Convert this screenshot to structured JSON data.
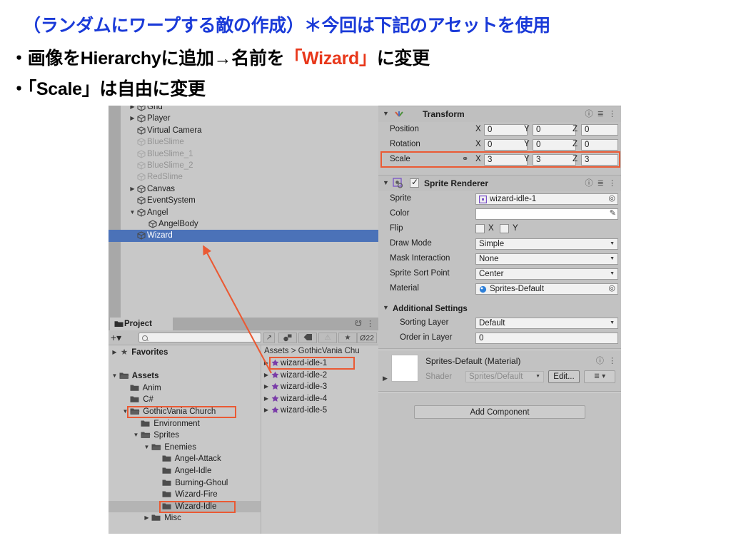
{
  "slide": {
    "line1": "（ランダムにワープする敵の作成）＊今回は下記のアセットを使用",
    "line2_a": "・画像をHierarchyに追加→名前を",
    "line2_b": "「Wizard」",
    "line2_c": "に変更",
    "line3": "・「Scale」は自由に変更",
    "accent_blue": "#1a3ad8",
    "accent_red": "#e8371a",
    "annotation_color": "#ea5a34"
  },
  "hierarchy": {
    "items": [
      {
        "label": "Grid",
        "indent": 1,
        "twisty": "▶",
        "state": "normal"
      },
      {
        "label": "Player",
        "indent": 1,
        "twisty": "▶",
        "state": "normal"
      },
      {
        "label": "Virtual Camera",
        "indent": 1,
        "twisty": "",
        "state": "normal"
      },
      {
        "label": "BlueSlime",
        "indent": 1,
        "twisty": "",
        "state": "dim"
      },
      {
        "label": "BlueSlime_1",
        "indent": 1,
        "twisty": "",
        "state": "dim"
      },
      {
        "label": "BlueSlime_2",
        "indent": 1,
        "twisty": "",
        "state": "dim"
      },
      {
        "label": "RedSlime",
        "indent": 1,
        "twisty": "",
        "state": "dim"
      },
      {
        "label": "Canvas",
        "indent": 1,
        "twisty": "▶",
        "state": "normal"
      },
      {
        "label": "EventSystem",
        "indent": 1,
        "twisty": "",
        "state": "normal"
      },
      {
        "label": "Angel",
        "indent": 1,
        "twisty": "▼",
        "state": "normal"
      },
      {
        "label": "AngelBody",
        "indent": 2,
        "twisty": "",
        "state": "normal"
      },
      {
        "label": "Wizard",
        "indent": 1,
        "twisty": "",
        "state": "selected"
      }
    ]
  },
  "project": {
    "tab_label": "Project",
    "search_placeholder": "",
    "hidden_count": "22",
    "breadcrumb": "Assets > GothicVania Chu",
    "tree": [
      {
        "label": "Favorites",
        "indent": 0,
        "twisty": "▶",
        "icon": "star",
        "bold": true,
        "selected": false,
        "boxed": false
      },
      {
        "label": "",
        "indent": 0,
        "twisty": "",
        "icon": "none",
        "bold": false,
        "selected": false,
        "boxed": false
      },
      {
        "label": "Assets",
        "indent": 0,
        "twisty": "▼",
        "icon": "folder-open",
        "bold": true,
        "selected": false,
        "boxed": false
      },
      {
        "label": "Anim",
        "indent": 1,
        "twisty": "",
        "icon": "folder",
        "bold": false,
        "selected": false,
        "boxed": false
      },
      {
        "label": "C#",
        "indent": 1,
        "twisty": "",
        "icon": "folder",
        "bold": false,
        "selected": false,
        "boxed": false
      },
      {
        "label": "GothicVania Church",
        "indent": 1,
        "twisty": "▼",
        "icon": "folder-open",
        "bold": false,
        "selected": false,
        "boxed": true
      },
      {
        "label": "Environment",
        "indent": 2,
        "twisty": "",
        "icon": "folder",
        "bold": false,
        "selected": false,
        "boxed": false
      },
      {
        "label": "Sprites",
        "indent": 2,
        "twisty": "▼",
        "icon": "folder-open",
        "bold": false,
        "selected": false,
        "boxed": false
      },
      {
        "label": "Enemies",
        "indent": 3,
        "twisty": "▼",
        "icon": "folder-open",
        "bold": false,
        "selected": false,
        "boxed": false
      },
      {
        "label": "Angel-Attack",
        "indent": 4,
        "twisty": "",
        "icon": "folder",
        "bold": false,
        "selected": false,
        "boxed": false
      },
      {
        "label": "Angel-Idle",
        "indent": 4,
        "twisty": "",
        "icon": "folder",
        "bold": false,
        "selected": false,
        "boxed": false
      },
      {
        "label": "Burning-Ghoul",
        "indent": 4,
        "twisty": "",
        "icon": "folder",
        "bold": false,
        "selected": false,
        "boxed": false
      },
      {
        "label": "Wizard-Fire",
        "indent": 4,
        "twisty": "",
        "icon": "folder",
        "bold": false,
        "selected": false,
        "boxed": false
      },
      {
        "label": "Wizard-Idle",
        "indent": 4,
        "twisty": "",
        "icon": "folder",
        "bold": false,
        "selected": true,
        "boxed": true
      },
      {
        "label": "Misc",
        "indent": 3,
        "twisty": "▶",
        "icon": "folder",
        "bold": false,
        "selected": false,
        "boxed": false
      }
    ],
    "assets": [
      {
        "label": "wizard-idle-1",
        "boxed": true
      },
      {
        "label": "wizard-idle-2",
        "boxed": false
      },
      {
        "label": "wizard-idle-3",
        "boxed": false
      },
      {
        "label": "wizard-idle-4",
        "boxed": false
      },
      {
        "label": "wizard-idle-5",
        "boxed": false
      }
    ]
  },
  "inspector": {
    "transform": {
      "title": "Transform",
      "rows": [
        {
          "label": "Position",
          "x": "0",
          "y": "0",
          "z": "0",
          "boxed": false,
          "link": false
        },
        {
          "label": "Rotation",
          "x": "0",
          "y": "0",
          "z": "0",
          "boxed": false,
          "link": false
        },
        {
          "label": "Scale",
          "x": "3",
          "y": "3",
          "z": "3",
          "boxed": true,
          "link": true
        }
      ],
      "axis_x": "X",
      "axis_y": "Y",
      "axis_z": "Z"
    },
    "sprite_renderer": {
      "title": "Sprite Renderer",
      "enabled": true,
      "fields": [
        {
          "label": "Sprite",
          "value": "wizard-idle-1",
          "kind": "object"
        },
        {
          "label": "Color",
          "value": "",
          "kind": "color"
        },
        {
          "label": "Flip",
          "value": "",
          "kind": "flip",
          "x_label": "X",
          "y_label": "Y"
        },
        {
          "label": "Draw Mode",
          "value": "Simple",
          "kind": "dropdown"
        },
        {
          "label": "Mask Interaction",
          "value": "None",
          "kind": "dropdown"
        },
        {
          "label": "Sprite Sort Point",
          "value": "Center",
          "kind": "dropdown"
        },
        {
          "label": "Material",
          "value": "Sprites-Default",
          "kind": "object"
        }
      ],
      "additional_settings_label": "Additional Settings",
      "additional": [
        {
          "label": "Sorting Layer",
          "value": "Default",
          "kind": "dropdown"
        },
        {
          "label": "Order in Layer",
          "value": "0",
          "kind": "text"
        }
      ]
    },
    "material": {
      "title": "Sprites-Default (Material)",
      "shader_label": "Shader",
      "shader_value": "Sprites/Default",
      "edit_label": "Edit..."
    },
    "add_component_label": "Add Component"
  }
}
